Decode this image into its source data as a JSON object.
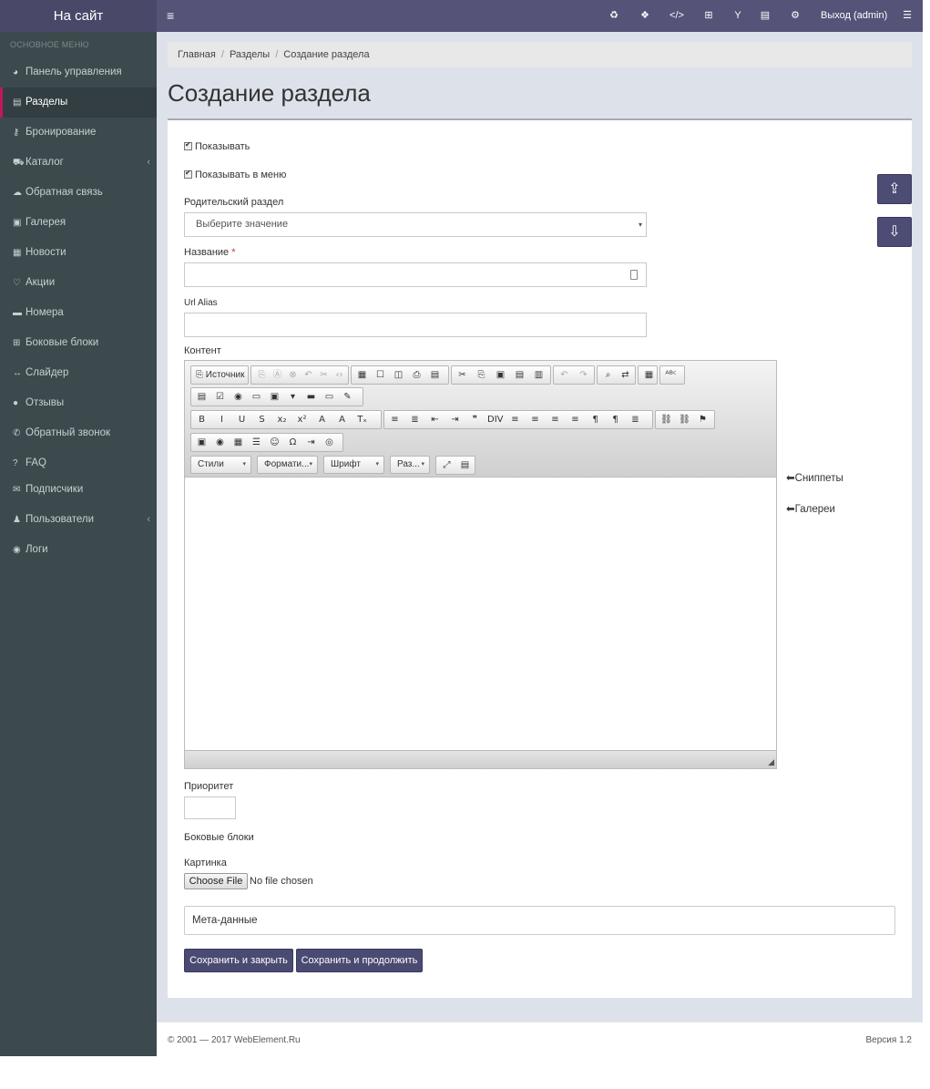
{
  "topbar": {
    "brand": "На сайт",
    "menu_glyph": "≡",
    "icons": [
      {
        "name": "recycle-icon",
        "glyph": "♻"
      },
      {
        "name": "cubes-icon",
        "glyph": "❖"
      },
      {
        "name": "code-icon",
        "glyph": "</>"
      },
      {
        "name": "sitemap-icon",
        "glyph": "⊞"
      },
      {
        "name": "yandex-icon",
        "glyph": "Y"
      },
      {
        "name": "file-icon",
        "glyph": "▤"
      },
      {
        "name": "cogs-icon",
        "glyph": "⚙"
      }
    ],
    "logout": "Выход (admin)",
    "list_glyph": "☰"
  },
  "sidebar": {
    "header": "ОСНОВНОЕ МЕНЮ",
    "items": [
      {
        "label": "Панель управления",
        "icon": "dashboard-icon",
        "glyph": "◕"
      },
      {
        "label": "Разделы",
        "icon": "file-text-icon",
        "glyph": "▤",
        "active": true
      },
      {
        "label": "Бронирование",
        "icon": "key-icon",
        "glyph": "⚷"
      },
      {
        "label": "Каталог",
        "icon": "cart-icon",
        "glyph": "⛟",
        "arrow": "‹"
      },
      {
        "label": "Обратная связь",
        "icon": "comments-icon",
        "glyph": "☁"
      },
      {
        "label": "Галерея",
        "icon": "image-icon",
        "glyph": "▣"
      },
      {
        "label": "Новости",
        "icon": "newspaper-icon",
        "glyph": "▦"
      },
      {
        "label": "Акции",
        "icon": "heart-icon",
        "glyph": "♡"
      },
      {
        "label": "Номера",
        "icon": "bed-icon",
        "glyph": "▬"
      },
      {
        "label": "Боковые блоки",
        "icon": "sitemap-icon",
        "glyph": "⊞"
      },
      {
        "label": "Слайдер",
        "icon": "arrows-h-icon",
        "glyph": "↔"
      },
      {
        "label": "Отзывы",
        "icon": "comment-icon",
        "glyph": "●"
      },
      {
        "label": "Обратный звонок",
        "icon": "phone-icon",
        "glyph": "✆"
      },
      {
        "label": "FAQ",
        "icon": "question-icon",
        "glyph": "?"
      },
      {
        "label": "Подписчики",
        "icon": "envelope-icon",
        "glyph": "✉"
      },
      {
        "label": "Пользователи",
        "icon": "user-icon",
        "glyph": "♟",
        "arrow": "‹"
      },
      {
        "label": "Логи",
        "icon": "eye-icon",
        "glyph": "◉"
      }
    ]
  },
  "breadcrumb": [
    "Главная",
    "Разделы",
    "Создание раздела"
  ],
  "breadcrumb_sep": "/",
  "page_title": "Создание раздела",
  "form": {
    "show_label": "Показывать",
    "show_in_menu_label": "Показывать в меню",
    "parent_label": "Родительский раздел",
    "parent_value": "Выберите значение",
    "select_arrow": "▾",
    "name_label": "Название",
    "required_mark": "*",
    "name_value": "",
    "alias_label": "Url Alias",
    "alias_value": "",
    "content_label": "Контент",
    "source_button": "Источник",
    "combos": [
      "Стили",
      "Формати...",
      "Шрифт",
      "Раз..."
    ],
    "combo_arrow": "▾",
    "resize_glyph": "◢",
    "snippets_link": "Сниппеты",
    "galleries_link": "Галереи",
    "arrow_glyph": "⬅",
    "priority_label": "Приоритет",
    "side_blocks_label": "Боковые блоки",
    "image_label": "Картинка",
    "file_button": "Choose File",
    "file_status": "No file chosen",
    "meta_label": "Мета-данные",
    "save_close": "Сохранить и закрыть",
    "save_continue": "Сохранить и продолжить",
    "float_up_glyph": "⇪",
    "float_down_glyph": "⇩"
  },
  "toolbar_rows": [
    [
      "⎘",
      "Ⓐ",
      "⊗",
      "↶",
      "✂",
      "‹›",
      "▦",
      "☐",
      "◫",
      "⎙",
      "▤",
      "✂",
      "⎘",
      "▣",
      "▤",
      "▥",
      "↶",
      "↷",
      "⌕",
      "⇄",
      "▦",
      "ᴬᴮᶜ"
    ],
    [
      "▤",
      "☑",
      "◉",
      "▭",
      "▣",
      "▾",
      "▬",
      "▭",
      "✎"
    ],
    [
      "B",
      "I",
      "U",
      "S",
      "x₂",
      "x²",
      "A",
      "A",
      "Tₓ",
      "≡",
      "≣",
      "⇤",
      "⇥",
      "❞",
      "DIV",
      "≡",
      "≡",
      "≡",
      "≡",
      "¶",
      "¶",
      "≣",
      "⛓",
      "⛓",
      "⚑"
    ],
    [
      "▣",
      "◉",
      "▦",
      "☰",
      "☺",
      "Ω",
      "⇥",
      "◎"
    ],
    [
      "⤢",
      "▤"
    ]
  ],
  "footer": {
    "copyright": "© 2001 — 2017 WebElement.Ru",
    "version": "Версия 1.2"
  }
}
